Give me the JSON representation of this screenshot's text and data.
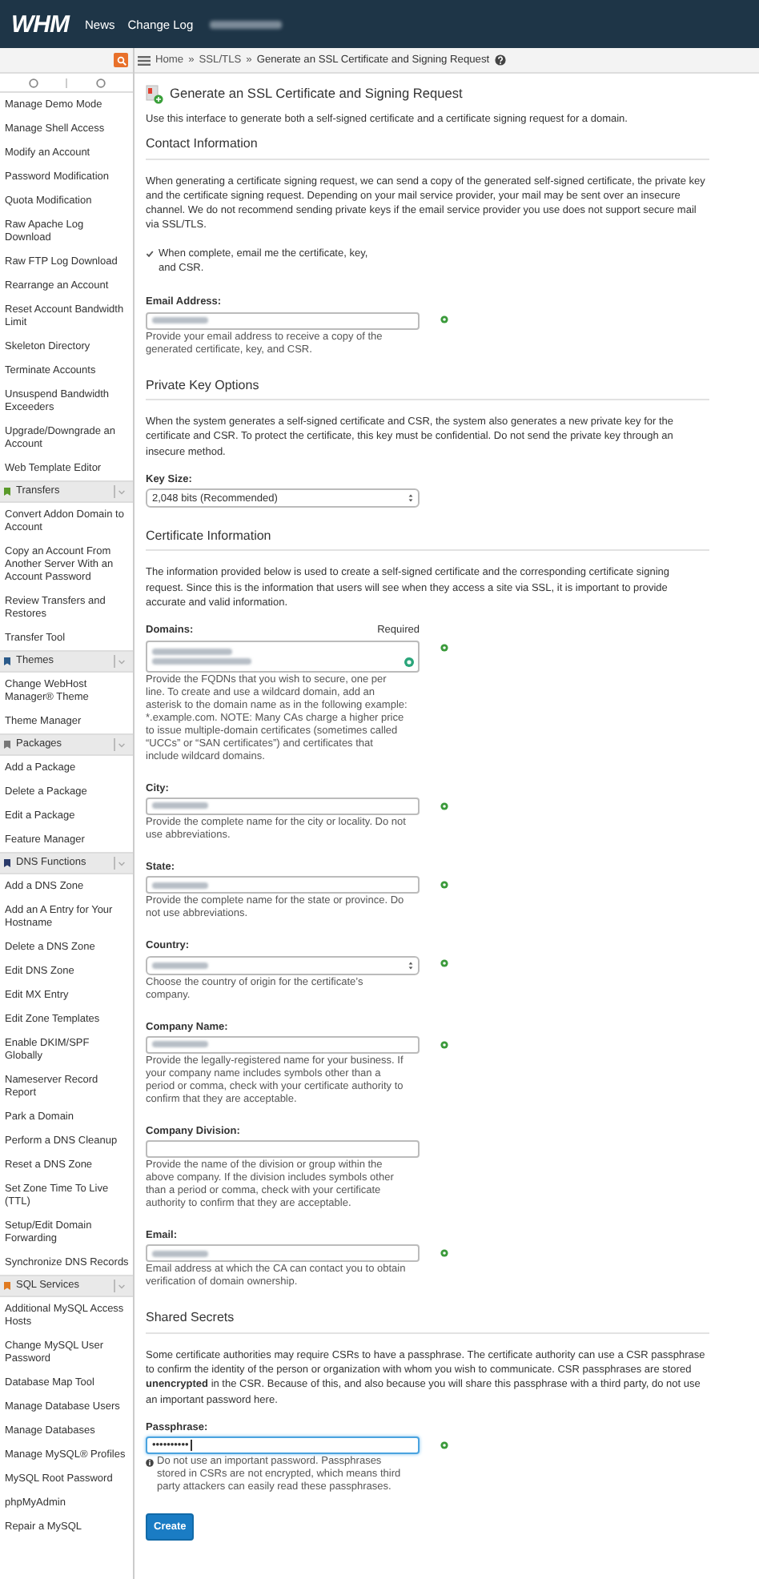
{
  "header": {
    "logo": "WHM",
    "nav": [
      {
        "label": "News"
      },
      {
        "label": "Change Log"
      }
    ]
  },
  "breadcrumb": {
    "items": [
      "Home",
      "SSL/TLS",
      "Generate an SSL Certificate and Signing Request"
    ],
    "separator": "»"
  },
  "sidebar": {
    "items": [
      {
        "kind": "link",
        "label": "Manage Demo Mode"
      },
      {
        "kind": "link",
        "label": "Manage Shell Access"
      },
      {
        "kind": "link",
        "label": "Modify an Account"
      },
      {
        "kind": "link",
        "label": "Password Modification"
      },
      {
        "kind": "link",
        "label": "Quota Modification"
      },
      {
        "kind": "link",
        "label": "Raw Apache Log Download"
      },
      {
        "kind": "link",
        "label": "Raw FTP Log Download"
      },
      {
        "kind": "link",
        "label": "Rearrange an Account"
      },
      {
        "kind": "link",
        "label": "Reset Account Bandwidth Limit"
      },
      {
        "kind": "link",
        "label": "Skeleton Directory"
      },
      {
        "kind": "link",
        "label": "Terminate Accounts"
      },
      {
        "kind": "link",
        "label": "Unsuspend Bandwidth Exceeders"
      },
      {
        "kind": "link",
        "label": "Upgrade/Downgrade an Account"
      },
      {
        "kind": "link",
        "label": "Web Template Editor"
      },
      {
        "kind": "group",
        "label": "Transfers",
        "color": "#5a9a2a"
      },
      {
        "kind": "link",
        "label": "Convert Addon Domain to Account"
      },
      {
        "kind": "link",
        "label": "Copy an Account From Another Server With an Account Password"
      },
      {
        "kind": "link",
        "label": "Review Transfers and Restores"
      },
      {
        "kind": "link",
        "label": "Transfer Tool"
      },
      {
        "kind": "group",
        "label": "Themes",
        "color": "#2a5a8a"
      },
      {
        "kind": "link",
        "label": "Change WebHost Manager® Theme"
      },
      {
        "kind": "link",
        "label": "Theme Manager"
      },
      {
        "kind": "group",
        "label": "Packages",
        "color": "#777777"
      },
      {
        "kind": "link",
        "label": "Add a Package"
      },
      {
        "kind": "link",
        "label": "Delete a Package"
      },
      {
        "kind": "link",
        "label": "Edit a Package"
      },
      {
        "kind": "link",
        "label": "Feature Manager"
      },
      {
        "kind": "group",
        "label": "DNS Functions",
        "color": "#2a3a6a"
      },
      {
        "kind": "link",
        "label": "Add a DNS Zone"
      },
      {
        "kind": "link",
        "label": "Add an A Entry for Your Hostname"
      },
      {
        "kind": "link",
        "label": "Delete a DNS Zone"
      },
      {
        "kind": "link",
        "label": "Edit DNS Zone"
      },
      {
        "kind": "link",
        "label": "Edit MX Entry"
      },
      {
        "kind": "link",
        "label": "Edit Zone Templates"
      },
      {
        "kind": "link",
        "label": "Enable DKIM/SPF Globally"
      },
      {
        "kind": "link",
        "label": "Nameserver Record Report"
      },
      {
        "kind": "link",
        "label": "Park a Domain"
      },
      {
        "kind": "link",
        "label": "Perform a DNS Cleanup"
      },
      {
        "kind": "link",
        "label": "Reset a DNS Zone"
      },
      {
        "kind": "link",
        "label": "Set Zone Time To Live (TTL)"
      },
      {
        "kind": "link",
        "label": "Setup/Edit Domain Forwarding"
      },
      {
        "kind": "link",
        "label": "Synchronize DNS Records"
      },
      {
        "kind": "group",
        "label": "SQL Services",
        "color": "#e07a20"
      },
      {
        "kind": "link",
        "label": "Additional MySQL Access Hosts"
      },
      {
        "kind": "link",
        "label": "Change MySQL User Password"
      },
      {
        "kind": "link",
        "label": "Database Map Tool"
      },
      {
        "kind": "link",
        "label": "Manage Database Users"
      },
      {
        "kind": "link",
        "label": "Manage Databases"
      },
      {
        "kind": "link",
        "label": "Manage MySQL® Profiles"
      },
      {
        "kind": "link",
        "label": "MySQL Root Password"
      },
      {
        "kind": "link",
        "label": "phpMyAdmin"
      },
      {
        "kind": "link",
        "label": "Repair a MySQL"
      }
    ]
  },
  "page": {
    "title": "Generate an SSL Certificate and Signing Request",
    "intro": "Use this interface to generate both a self-signed certificate and a certificate signing request for a domain.",
    "sections": [
      {
        "heading": "Contact Information",
        "description": "When generating a certificate signing request, we can send a copy of the generated self-signed certificate, the private key and the certificate signing request. Depending on your mail service provider, your mail may be sent over an insecure channel. We do not recommend sending private keys if the email service provider you use does not support secure mail via SSL/TLS.",
        "fields": [
          {
            "kind": "checkbox",
            "label": "When complete, email me the certificate, key, and CSR.",
            "checked": true
          },
          {
            "kind": "text",
            "label": "Email Address:",
            "redacted": true,
            "valid": true,
            "help": "Provide your email address to receive a copy of the generated certificate, key, and CSR."
          }
        ]
      },
      {
        "heading": "Private Key Options",
        "description": "When the system generates a self-signed certificate and CSR, the system also generates a new private key for the certificate and CSR. To protect the certificate, this key must be confidential. Do not send the private key through an insecure method.",
        "fields": [
          {
            "kind": "select",
            "label": "Key Size:",
            "value": "2,048 bits (Recommended)",
            "valid": false
          }
        ]
      },
      {
        "heading": "Certificate Information",
        "description": "The information provided below is used to create a self-signed certificate and the corresponding certificate signing request. Since this is the information that users will see when they access a site via SSL, it is important to provide accurate and valid information.",
        "fields": [
          {
            "kind": "textarea",
            "label": "Domains:",
            "required": "Required",
            "redacted": true,
            "valid": true,
            "help": "Provide the FQDNs that you wish to secure, one per line. To create and use a wildcard domain, add an asterisk to the domain name as in the following example: *.example.com. NOTE: Many CAs charge a higher price to issue multiple-domain certificates (sometimes called “UCCs” or “SAN certificates”) and certificates that include wildcard domains."
          },
          {
            "kind": "text",
            "label": "City:",
            "redacted": true,
            "valid": true,
            "help": "Provide the complete name for the city or locality. Do not use abbreviations."
          },
          {
            "kind": "text",
            "label": "State:",
            "redacted": true,
            "valid": true,
            "help": "Provide the complete name for the state or province. Do not use abbreviations."
          },
          {
            "kind": "select",
            "label": "Country:",
            "redacted": true,
            "valid": true,
            "help": "Choose the country of origin for the certificate’s company."
          },
          {
            "kind": "text",
            "label": "Company Name:",
            "redacted": true,
            "valid": true,
            "help": "Provide the legally-registered name for your business. If your company name includes symbols other than a period or comma, check with your certificate authority to confirm that they are acceptable."
          },
          {
            "kind": "text",
            "label": "Company Division:",
            "redacted": false,
            "valid": false,
            "help": "Provide the name of the division or group within the above company. If the division includes symbols other than a period or comma, check with your certificate authority to confirm that they are acceptable."
          },
          {
            "kind": "text",
            "label": "Email:",
            "redacted": true,
            "valid": true,
            "help": "Email address at which the CA can contact you to obtain verification of domain ownership."
          }
        ]
      },
      {
        "heading": "Shared Secrets",
        "description": "Some certificate authorities may require CSRs to have a passphrase. The certificate authority can use a CSR passphrase to confirm the identity of the person or organization with whom you wish to communicate. CSR passphrases are stored **unencrypted** in the CSR. Because of this, and also because you will share this passphrase with a third party, do not use an important password here.",
        "fields": [
          {
            "kind": "password",
            "label": "Passphrase:",
            "value": "••••••••••",
            "focused": true,
            "valid": true,
            "note_icon": true,
            "help": "Do not use an important password. Passphrases stored in CSRs are not encrypted, which means third party attackers can easily read these passphrases."
          }
        ]
      }
    ],
    "button": {
      "label": "Create"
    }
  }
}
